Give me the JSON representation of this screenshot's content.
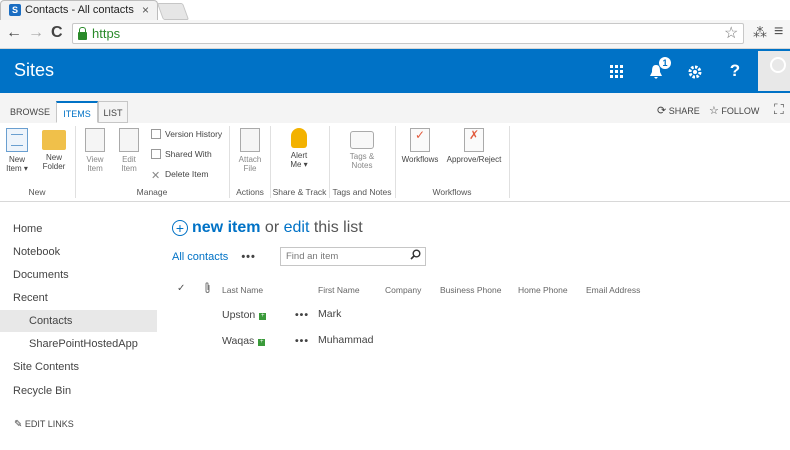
{
  "browser": {
    "tab_title": "Contacts - All contacts",
    "tab_close": "×",
    "url": "https",
    "back": "←",
    "forward": "→",
    "reload": "C",
    "star": "☆",
    "menu": "≡",
    "ext": "⁂"
  },
  "suite": {
    "title": "Sites",
    "notification_count": "1",
    "icons": [
      "app-launcher-icon",
      "notification-bell-icon",
      "settings-gear-icon",
      "help-icon"
    ],
    "help": "?"
  },
  "ribbon_tabs": {
    "browse": "BROWSE",
    "items": "ITEMS",
    "list": "LIST"
  },
  "actions": {
    "share": "SHARE",
    "follow": "FOLLOW"
  },
  "ribbon": {
    "new_item": "New\nItem ▾",
    "new_folder": "New\nFolder",
    "view_item": "View\nItem",
    "edit_item": "Edit\nItem",
    "version_history": "Version History",
    "shared_with": "Shared With",
    "delete_item": "Delete Item",
    "attach_file": "Attach\nFile",
    "alert_me": "Alert\nMe ▾",
    "tags_notes": "Tags &\nNotes",
    "workflows": "Workflows",
    "approve_reject": "Approve/Reject",
    "groups": {
      "new": "New",
      "manage": "Manage",
      "actions": "Actions",
      "share_track": "Share & Track",
      "tags": "Tags and Notes",
      "workflows": "Workflows"
    }
  },
  "nav": {
    "items": [
      "Home",
      "Notebook",
      "Documents",
      "Recent",
      "Contacts",
      "SharePointHostedApp",
      "Site Contents",
      "Recycle Bin"
    ],
    "edit_links": "EDIT LINKS"
  },
  "main": {
    "new_item": "new item",
    "or": " or ",
    "edit": "edit",
    "this_list": " this list",
    "view": "All contacts",
    "more": "•••",
    "search_placeholder": "Find an item",
    "columns": [
      "Last Name",
      "First Name",
      "Company",
      "Business Phone",
      "Home Phone",
      "Email Address"
    ],
    "rows": [
      {
        "last": "Upston",
        "first": "Mark"
      },
      {
        "last": "Waqas",
        "first": "Muhammad"
      }
    ]
  },
  "colors": {
    "suite_blue": "#0072c6",
    "link": "#0072c6"
  }
}
